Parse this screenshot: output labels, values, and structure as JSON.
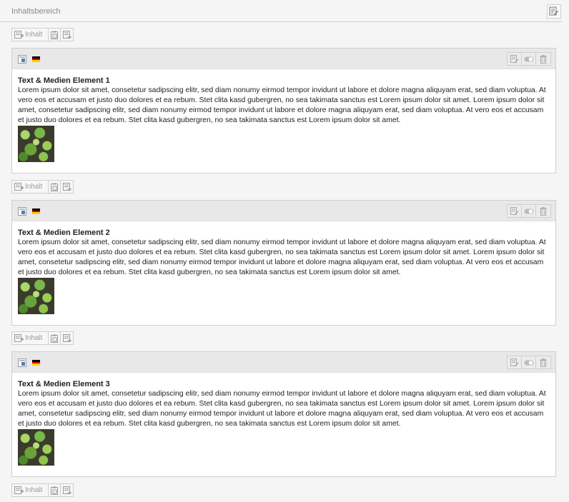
{
  "header": {
    "title": "Inhaltsbereich"
  },
  "toolbar": {
    "new_label": "Inhalt"
  },
  "colors": {
    "flag_black": "#000000",
    "flag_red": "#dd0000",
    "flag_gold": "#ffce00",
    "icon_blue": "#4a7fc1"
  },
  "elements": [
    {
      "title": "Text & Medien Element 1",
      "text": "Lorem ipsum dolor sit amet, consetetur sadipscing elitr, sed diam nonumy eirmod tempor invidunt ut labore et dolore magna aliquyam erat, sed diam voluptua. At vero eos et accusam et justo duo dolores et ea rebum. Stet clita kasd gubergren, no sea takimata sanctus est Lorem ipsum dolor sit amet. Lorem ipsum dolor sit amet, consetetur sadipscing elitr, sed diam nonumy eirmod tempor invidunt ut labore et dolore magna aliquyam erat, sed diam voluptua. At vero eos et accusam et justo duo dolores et ea rebum. Stet clita kasd gubergren, no sea takimata sanctus est Lorem ipsum dolor sit amet."
    },
    {
      "title": "Text & Medien Element 2",
      "text": "Lorem ipsum dolor sit amet, consetetur sadipscing elitr, sed diam nonumy eirmod tempor invidunt ut labore et dolore magna aliquyam erat, sed diam voluptua. At vero eos et accusam et justo duo dolores et ea rebum. Stet clita kasd gubergren, no sea takimata sanctus est Lorem ipsum dolor sit amet. Lorem ipsum dolor sit amet, consetetur sadipscing elitr, sed diam nonumy eirmod tempor invidunt ut labore et dolore magna aliquyam erat, sed diam voluptua. At vero eos et accusam et justo duo dolores et ea rebum. Stet clita kasd gubergren, no sea takimata sanctus est Lorem ipsum dolor sit amet."
    },
    {
      "title": "Text & Medien Element 3",
      "text": "Lorem ipsum dolor sit amet, consetetur sadipscing elitr, sed diam nonumy eirmod tempor invidunt ut labore et dolore magna aliquyam erat, sed diam voluptua. At vero eos et accusam et justo duo dolores et ea rebum. Stet clita kasd gubergren, no sea takimata sanctus est Lorem ipsum dolor sit amet. Lorem ipsum dolor sit amet, consetetur sadipscing elitr, sed diam nonumy eirmod tempor invidunt ut labore et dolore magna aliquyam erat, sed diam voluptua. At vero eos et accusam et justo duo dolores et ea rebum. Stet clita kasd gubergren, no sea takimata sanctus est Lorem ipsum dolor sit amet."
    }
  ]
}
